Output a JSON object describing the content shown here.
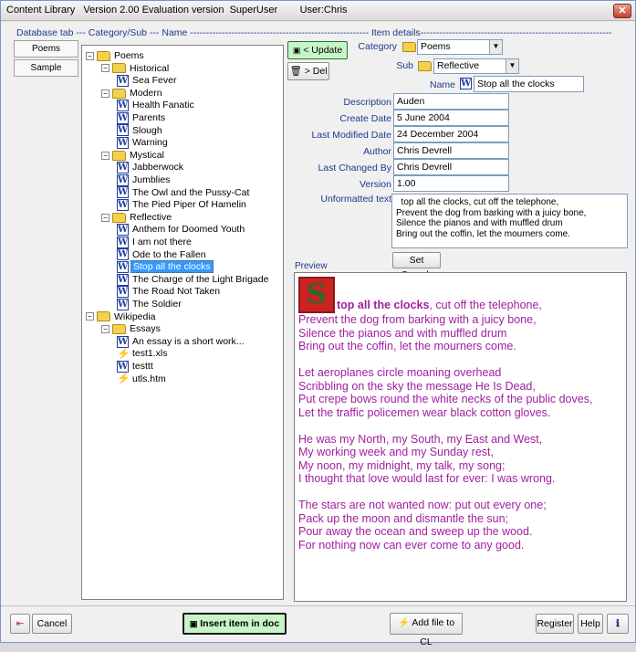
{
  "window": {
    "title": "Content Library   Version 2.00 Evaluation version  SuperUser        User:Chris",
    "close": "✕"
  },
  "header_line": "Database tab --- Category/Sub --- Name -------------------------------------------------------- Item details------------------------------------------------------------",
  "left_tabs": [
    "Poems",
    "Sample"
  ],
  "tree": {
    "nodes": [
      {
        "label": "Poems",
        "type": "folder",
        "toggle": "−"
      },
      {
        "label": "Historical",
        "type": "folder",
        "toggle": "−"
      },
      {
        "label": "Sea Fever",
        "type": "doc"
      },
      {
        "label": "Modern",
        "type": "folder",
        "toggle": "−"
      },
      {
        "label": "Health Fanatic",
        "type": "doc"
      },
      {
        "label": "Parents",
        "type": "doc"
      },
      {
        "label": "Slough",
        "type": "doc"
      },
      {
        "label": "Warning",
        "type": "doc"
      },
      {
        "label": "Mystical",
        "type": "folder",
        "toggle": "−"
      },
      {
        "label": "Jabberwock",
        "type": "doc"
      },
      {
        "label": "Jumblies",
        "type": "doc"
      },
      {
        "label": "The Owl and the Pussy-Cat",
        "type": "doc"
      },
      {
        "label": "The Pied Piper Of Hamelin",
        "type": "doc"
      },
      {
        "label": "Reflective",
        "type": "folder",
        "toggle": "−"
      },
      {
        "label": "Anthem for Doomed Youth",
        "type": "doc"
      },
      {
        "label": "I am not there",
        "type": "doc"
      },
      {
        "label": "Ode to the Fallen",
        "type": "doc"
      },
      {
        "label": "Stop all the clocks",
        "type": "doc"
      },
      {
        "label": "The Charge of the Light Brigade",
        "type": "doc"
      },
      {
        "label": "The Road Not Taken",
        "type": "doc"
      },
      {
        "label": "The Soldier",
        "type": "doc"
      },
      {
        "label": "Wikipedia",
        "type": "folder",
        "toggle": "−"
      },
      {
        "label": "Essays",
        "type": "folder",
        "toggle": "−"
      },
      {
        "label": "An essay is a short work...",
        "type": "doc"
      },
      {
        "label": "test1.xls",
        "type": "bolt"
      },
      {
        "label": "testtt",
        "type": "doc"
      },
      {
        "label": "utls.htm",
        "type": "bolt"
      }
    ]
  },
  "buttons": {
    "update": "< Update",
    "del": "> Del",
    "set_search": "Set Search",
    "cancel": "Cancel",
    "insert": "Insert item in doc",
    "add_file": "Add file to CL",
    "register": "Register",
    "help": "Help"
  },
  "details": {
    "category_label": "Category",
    "category_value": "Poems",
    "sub_label": "Sub",
    "sub_value": "Reflective",
    "name_label": "Name",
    "name_value": "Stop all the clocks",
    "description_label": "Description",
    "description_value": "Auden",
    "create_date_label": "Create Date",
    "create_date_value": "5 June 2004",
    "last_modified_label": "Last Modified Date",
    "last_modified_value": "24 December 2004",
    "author_label": "Author",
    "author_value": "Chris Devrell",
    "last_changed_label": "Last Changed By",
    "last_changed_value": "Chris Devrell",
    "version_label": "Version",
    "version_value": "1.00",
    "unformatted_label": "Unformatted text",
    "unformatted_value": "  top all the clocks, cut off the telephone,\nPrevent the dog from barking with a juicy bone,\nSilence the pianos and with muffled drum\nBring out the coffin, let the mourners come."
  },
  "preview": {
    "label": "Preview",
    "drop_cap": "S",
    "first_bold": "top all the clocks",
    "first_rest": ", cut off the telephone,",
    "body": "Prevent the dog from barking with a juicy bone,\nSilence the pianos and with muffled drum\nBring out the coffin, let the mourners come.\n\nLet aeroplanes circle moaning overhead\nScribbling on the sky the message He Is Dead,\nPut crepe bows round the white necks of the public doves,\nLet the traffic policemen wear black cotton gloves.\n\nHe was my North, my South, my East and West,\nMy working week and my Sunday rest,\nMy noon, my midnight, my talk, my song;\nI thought that love would last for ever: I was wrong.\n\nThe stars are not wanted now: put out every one;\nPack up the moon and dismantle the sun;\nPour away the ocean and sweep up the wood.\nFor nothing now can ever come to any good."
  },
  "colors": {
    "accent_label": "#1e3a8a",
    "preview_text": "#a020a0",
    "selection": "#3399ff"
  }
}
